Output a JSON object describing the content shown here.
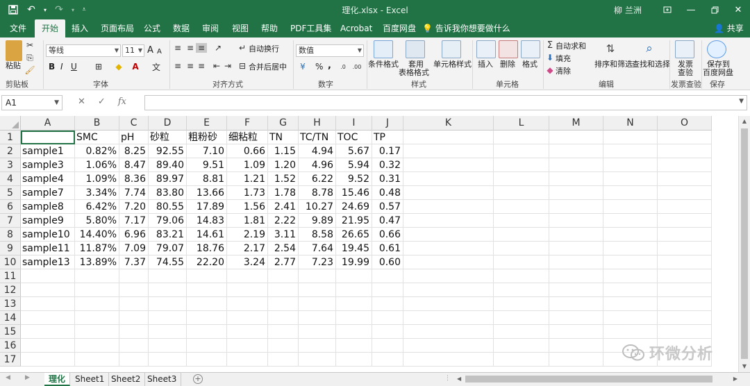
{
  "titlebar": {
    "title": "理化.xlsx  -  Excel",
    "user": "柳 兰洲",
    "minimize_icon": "minimize-icon",
    "restore_icon": "restore-icon",
    "close_icon": "close-icon"
  },
  "tabs": [
    "文件",
    "开始",
    "插入",
    "页面布局",
    "公式",
    "数据",
    "审阅",
    "视图",
    "帮助",
    "PDF工具集",
    "Acrobat",
    "百度网盘"
  ],
  "active_tab": "开始",
  "tell_me": "告诉我你想要做什么",
  "share": "共享",
  "ribbon": {
    "clipboard": {
      "paste": "粘贴",
      "label": "剪贴板"
    },
    "font": {
      "name": "等线",
      "size": "11",
      "bold": "B",
      "italic": "I",
      "underline": "U",
      "grow": "A",
      "shrink": "A",
      "label": "字体"
    },
    "alignment": {
      "wrap": "自动换行",
      "merge": "合并后居中",
      "label": "对齐方式"
    },
    "number": {
      "format": "数值",
      "percent": "%",
      "comma": ",",
      "label": "数字"
    },
    "styles": {
      "conditional": "条件格式",
      "table1": "套用",
      "table2": "表格格式",
      "cell": "单元格样式",
      "label": "样式"
    },
    "cells": {
      "insert": "插入",
      "delete": "删除",
      "format": "格式",
      "label": "单元格"
    },
    "editing": {
      "autosum": "自动求和",
      "fill": "填充",
      "clear": "清除",
      "sort": "排序和筛选",
      "find": "查找和选择",
      "label": "编辑"
    },
    "invoice": {
      "btn1": "发票",
      "btn2": "查验",
      "label": "发票查验"
    },
    "save": {
      "btn1": "保存到",
      "btn2": "百度网盘",
      "label": "保存"
    }
  },
  "namebox": "A1",
  "fx": "fx",
  "columns": [
    "A",
    "B",
    "C",
    "D",
    "E",
    "F",
    "G",
    "H",
    "I",
    "J",
    "K",
    "L",
    "M",
    "N",
    "O"
  ],
  "rows": [
    "1",
    "2",
    "3",
    "4",
    "5",
    "6",
    "7",
    "8",
    "9",
    "10",
    "11",
    "12",
    "13",
    "14",
    "15",
    "16",
    "17"
  ],
  "headers": [
    "",
    "SMC",
    "pH",
    "砂粒",
    "粗粉砂",
    "细粘粒",
    "TN",
    "TC/TN",
    "TOC",
    "TP"
  ],
  "data": [
    [
      "sample1",
      "0.82%",
      "8.25",
      "92.55",
      "7.10",
      "0.66",
      "1.15",
      "4.94",
      "5.67",
      "0.17"
    ],
    [
      "sample3",
      "1.06%",
      "8.47",
      "89.40",
      "9.51",
      "1.09",
      "1.20",
      "4.96",
      "5.94",
      "0.32"
    ],
    [
      "sample4",
      "1.09%",
      "8.36",
      "89.97",
      "8.81",
      "1.21",
      "1.52",
      "6.22",
      "9.52",
      "0.31"
    ],
    [
      "sample7",
      "3.34%",
      "7.74",
      "83.80",
      "13.66",
      "1.73",
      "1.78",
      "8.78",
      "15.46",
      "0.48"
    ],
    [
      "sample8",
      "6.42%",
      "7.20",
      "80.55",
      "17.89",
      "1.56",
      "2.41",
      "10.27",
      "24.69",
      "0.57"
    ],
    [
      "sample9",
      "5.80%",
      "7.17",
      "79.06",
      "14.83",
      "1.81",
      "2.22",
      "9.89",
      "21.95",
      "0.47"
    ],
    [
      "sample10",
      "14.40%",
      "6.96",
      "83.21",
      "14.61",
      "2.19",
      "3.11",
      "8.58",
      "26.65",
      "0.66"
    ],
    [
      "sample11",
      "11.87%",
      "7.09",
      "79.07",
      "18.76",
      "2.17",
      "2.54",
      "7.64",
      "19.45",
      "0.61"
    ],
    [
      "sample13",
      "13.89%",
      "7.37",
      "74.55",
      "22.20",
      "3.24",
      "2.77",
      "7.23",
      "19.99",
      "0.60"
    ]
  ],
  "sheets": [
    "理化",
    "Sheet1",
    "Sheet2",
    "Sheet3"
  ],
  "active_sheet": "理化",
  "watermark": "环微分析",
  "accent_color": "#217346"
}
